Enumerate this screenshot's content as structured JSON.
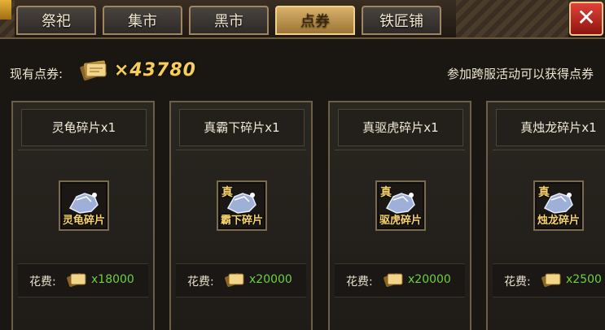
{
  "tabs": [
    {
      "label": "祭祀",
      "active": false
    },
    {
      "label": "集市",
      "active": false
    },
    {
      "label": "黑市",
      "active": false
    },
    {
      "label": "点券",
      "active": true
    },
    {
      "label": "铁匠铺",
      "active": false
    }
  ],
  "close_label": "✕",
  "coupons": {
    "label": "现有点券:",
    "count": "×43780",
    "hint": "参加跨服活动可以获得点券"
  },
  "cost_label": "花费:",
  "items": [
    {
      "name": "灵龟碎片x1",
      "prefix": "",
      "icon_label": "灵龟碎片",
      "price": "x18000"
    },
    {
      "name": "真霸下碎片x1",
      "prefix": "真",
      "icon_label": "霸下碎片",
      "price": "x20000"
    },
    {
      "name": "真驱虎碎片x1",
      "prefix": "真",
      "icon_label": "驱虎碎片",
      "price": "x20000"
    },
    {
      "name": "真烛龙碎片x1",
      "prefix": "真",
      "icon_label": "烛龙碎片",
      "price": "x2500"
    }
  ],
  "colors": {
    "accent_gold": "#f5cf5a",
    "price_green": "#6bd13c",
    "active_tab": "#d8b26a",
    "close_red": "#c4261e"
  }
}
